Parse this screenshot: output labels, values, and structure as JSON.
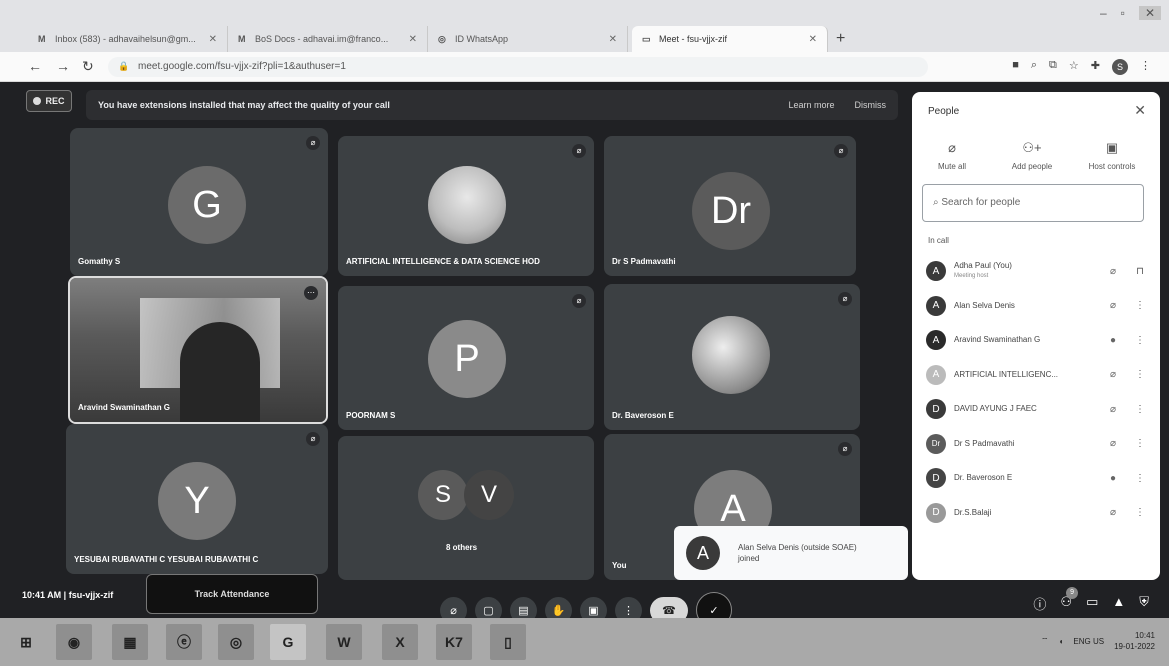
{
  "browser": {
    "tabs": [
      {
        "label": "Inbox (583) - adhavaihelsun@gm...",
        "icon": "gmail-icon"
      },
      {
        "label": "BoS Docs - adhavai.im@franco...",
        "icon": "gmail-icon"
      },
      {
        "label": "ID WhatsApp",
        "icon": "whatsapp-icon"
      },
      {
        "label": "Meet - fsu-vjjx-zif",
        "icon": "meet-icon"
      }
    ],
    "url": "meet.google.com/fsu-vjjx-zif?pli=1&authuser=1",
    "profile_initial": "S"
  },
  "meet": {
    "rec_label": "REC",
    "banner": {
      "message": "You have extensions installed that may affect the quality of your call",
      "learn_more": "Learn more",
      "dismiss": "Dismiss"
    },
    "tiles": [
      {
        "name": "Gomathy S",
        "initial": "G",
        "color": "#6b6b6b"
      },
      {
        "name": "ARTIFICIAL INTELLIGENCE & DATA SCIENCE HOD",
        "initial": "",
        "color": "#bdbdbd"
      },
      {
        "name": "Dr S Padmavathi",
        "initial": "Dr",
        "color": "#5b5b5b"
      },
      {
        "name": "Aravind Swaminathan G",
        "initial": "",
        "color": "#555"
      },
      {
        "name": "POORNAM S",
        "initial": "P",
        "color": "#8a8a8a"
      },
      {
        "name": "Dr. Baveroson E",
        "initial": "",
        "color": "#bbb"
      },
      {
        "name": "YESUBAI RUBAVATHI C YESUBAI RUBAVATHI C",
        "initial": "Y",
        "color": "#7a7a7a"
      },
      {
        "name": "8 others",
        "initial": "",
        "color": "#555"
      },
      {
        "name": "You",
        "initial": "A",
        "color": "#7d7d7d"
      }
    ],
    "others_initials": [
      "S",
      "V"
    ],
    "toast": {
      "initial": "A",
      "text": "Alan Selva Denis (outside SOAE) joined"
    },
    "clock": "10:41 AM  |  fsu-vjjx-zif",
    "track_attendance": "Track Attendance"
  },
  "people": {
    "title": "People",
    "actions": [
      "Mute all",
      "Add people",
      "Host controls"
    ],
    "search_placeholder": "Search for people",
    "in_call_label": "In call",
    "participants": [
      {
        "initial": "A",
        "name": "Adha Paul (You)",
        "sub": "Meeting host"
      },
      {
        "initial": "A",
        "name": "Alan Selva Denis",
        "sub": ""
      },
      {
        "initial": "A",
        "name": "Aravind Swaminathan G",
        "sub": ""
      },
      {
        "initial": "A",
        "name": "ARTIFICIAL INTELLIGENC...",
        "sub": ""
      },
      {
        "initial": "D",
        "name": "DAVID AYUNG J FAEC",
        "sub": ""
      },
      {
        "initial": "Dr",
        "name": "Dr S Padmavathi",
        "sub": ""
      },
      {
        "initial": "D",
        "name": "Dr. Baveroson E",
        "sub": ""
      },
      {
        "initial": "D",
        "name": "Dr.S.Balaji",
        "sub": ""
      }
    ]
  },
  "taskbar": {
    "time": "10:41",
    "date": "19-01-2022",
    "lang": "ENG US",
    "app_labels": [
      "K7"
    ]
  }
}
